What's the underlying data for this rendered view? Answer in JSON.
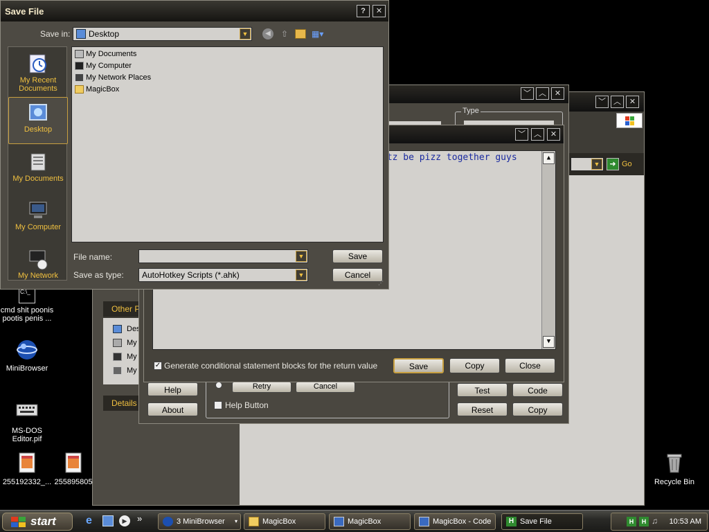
{
  "save_dialog": {
    "title": "Save File",
    "help_glyph": "?",
    "close_glyph": "✕",
    "save_in_label": "Save in:",
    "save_in_value": "Desktop",
    "places": [
      "My Recent Documents",
      "Desktop",
      "My Documents",
      "My Computer",
      "My Network"
    ],
    "files": [
      "My Documents",
      "My Computer",
      "My Network Places",
      "MagicBox"
    ],
    "file_name_label": "File name:",
    "file_name_value": "",
    "save_as_type_label": "Save as type:",
    "save_as_type_value": "AutoHotkey Scripts (*.ahk)",
    "save_button": "Save",
    "cancel_button": "Cancel"
  },
  "code_window": {
    "code_text": "etz be pizz together guys",
    "checkbox_label": "Generate conditional statement blocks for the return value",
    "checkbox_checked": true,
    "save_button": "Save",
    "copy_button": "Copy",
    "close_button": "Close"
  },
  "magicbox_window": {
    "type_label": "Type",
    "help_button": "Help",
    "about_button": "About",
    "retry_button": "Retry",
    "cancel_button": "Cancel",
    "help_checkbox_label": "Help Button",
    "test_button": "Test",
    "code_button": "Code",
    "reset_button": "Reset",
    "copy_button": "Copy"
  },
  "explorer_window": {
    "go_label": "Go",
    "other_places_label": "Other P",
    "other_places_items": [
      "Des",
      "My",
      "My",
      "My"
    ],
    "details_label": "Details"
  },
  "desktop": {
    "icons": [
      {
        "label": "cmd shit poonis pootis penis ..."
      },
      {
        "label": "MiniBrowser"
      },
      {
        "label": "MS-DOS Editor.pif"
      },
      {
        "label": "255192332_..."
      },
      {
        "label": "255895805"
      },
      {
        "label": "Recycle Bin"
      }
    ]
  },
  "taskbar": {
    "start_label": "start",
    "quick_launch_more": "»",
    "buttons": [
      {
        "label": "3 MiniBrowser",
        "icon": "browser-icon"
      },
      {
        "label": "MagicBox",
        "icon": "folder-icon"
      },
      {
        "label": "MagicBox",
        "icon": "window-icon"
      },
      {
        "label": "MagicBox - Code",
        "icon": "window-icon"
      },
      {
        "label": "Save File",
        "icon": "ahk-icon"
      }
    ],
    "clock": "10:53 AM"
  },
  "colors": {
    "accent_gold": "#c8a040",
    "dialog_bg": "#4d4a43",
    "field_bg": "#d3d1cd",
    "code_text": "#1a2aa0"
  }
}
